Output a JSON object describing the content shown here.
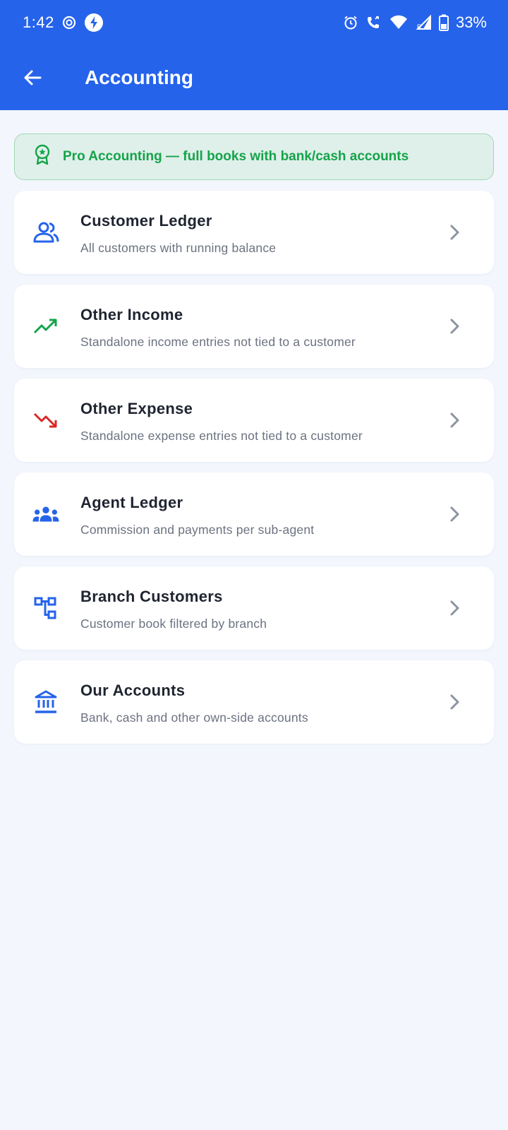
{
  "status_bar": {
    "time": "1:42",
    "battery": "33%",
    "icons": [
      "screen-record-icon",
      "bolt-icon",
      "alarm-icon",
      "wifi-calling-icon",
      "wifi-icon",
      "signal-roaming-icon",
      "battery-icon"
    ]
  },
  "app_bar": {
    "title": "Accounting",
    "back_icon": "arrow-back-icon",
    "color": "#2563eb"
  },
  "banner": {
    "text": "Pro Accounting — full books with bank/cash accounts",
    "icon": "award-badge-icon",
    "color": "#16a34a"
  },
  "items": [
    {
      "title": "Customer Ledger",
      "subtitle": "All customers with running balance",
      "icon": "customers-icon",
      "icon_color": "#2563eb"
    },
    {
      "title": "Other Income",
      "subtitle": "Standalone income entries not tied to a customer",
      "icon": "trending-up-icon",
      "icon_color": "#16a34a"
    },
    {
      "title": "Other Expense",
      "subtitle": "Standalone expense entries not tied to a customer",
      "icon": "trending-down-icon",
      "icon_color": "#dc2626"
    },
    {
      "title": "Agent Ledger",
      "subtitle": "Commission and payments per sub-agent",
      "icon": "group-icon",
      "icon_color": "#2563eb"
    },
    {
      "title": "Branch Customers",
      "subtitle": "Customer book filtered by branch",
      "icon": "branch-tree-icon",
      "icon_color": "#2563eb"
    },
    {
      "title": "Our Accounts",
      "subtitle": "Bank, cash and other own-side accounts",
      "icon": "bank-icon",
      "icon_color": "#2563eb"
    }
  ]
}
